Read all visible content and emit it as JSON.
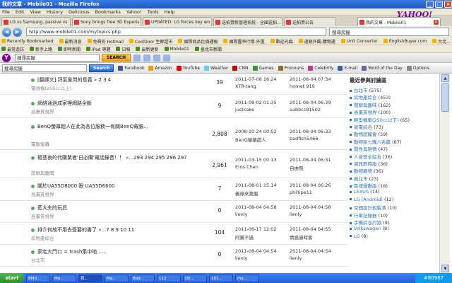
{
  "window": {
    "title": "我的文章 - Mobile01 - Mozilla Firefox",
    "min": "_",
    "max": "□",
    "close": "×"
  },
  "menu": [
    "File",
    "Edit",
    "View",
    "History",
    "Delicious",
    "Bookmarks",
    "Yahoo!",
    "Tools",
    "Help"
  ],
  "tabs": [
    {
      "label": "LG vs Samsung, passive vs act..."
    },
    {
      "label": "Sony brings free 3D Experienc..."
    },
    {
      "label": "UPDATED: LG forces key world..."
    },
    {
      "label": "送拍賣新管理系統 - 全國送拍..."
    },
    {
      "label": "送拍賣公告"
    },
    {
      "label": "我的文章 - Mobile01"
    }
  ],
  "yahoo_logo": "YAHOO!",
  "nav": {
    "back": "◀",
    "forward": "▶",
    "url": "http://www.mobile01.com/mytopics.php",
    "search_value": "搜尋房屋"
  },
  "bookmarks": [
    "Recently Bookmarked",
    "最新消息",
    "免費的 Hotmail",
    "CoolDoor 生鮮超市",
    "國際商品比價通報",
    "國際匯率行情-外匯",
    "歡迎光臨",
    "遠銷外觀-購物通",
    "Unit Converter",
    "EnglishBuyer.com",
    "台北..."
  ],
  "links_bar": [
    "最常造訪",
    "新手上路",
    "即時新聞",
    "iPad 專題",
    "日報",
    "最新更新",
    "Mobile01",
    "臺北市新聞"
  ],
  "ytoolbar": {
    "logo": "Y",
    "search_value": "搜尋房屋",
    "search_label": "SEARCH"
  },
  "ytoolbar2": {
    "search_value": "搜尋房屋",
    "search_label": "Search",
    "items": [
      "Facebook",
      "Amazon",
      "YouTube",
      "Weather",
      "CNN",
      "Games",
      "Pronouns",
      "Celebrity",
      "E-mail",
      "Word of the Day",
      "Options"
    ]
  },
  "rows": [
    {
      "topic": "[翻譯文] 拜氣象閃的意義 » 2 3 4",
      "sub": "電視機(250cc以上)",
      "count": "39",
      "date1": "2011-07-08 16:24",
      "user1": "XTR-tang",
      "date2": "2011-08-04 07:34",
      "user2": "hornet 919"
    },
    {
      "topic": "網絡通過成家裡網路全斷",
      "sub": "高畫質視界",
      "count": "9",
      "date1": "2011-08-02 01:35",
      "user1": "justcake",
      "date2": "2011-08-04 06:39",
      "user2": "aabbcc81502"
    },
    {
      "topic": "BenQ螢幕超人在此為各位服務一有關BenQ電腦...",
      "sub": "電腦螢幕",
      "count": "2,808",
      "date1": "2008-10-24 00:02",
      "user1": "BenQ螢幕超人",
      "date2": "2011-08-04 06:33",
      "user2": "badfish5466"
    },
    {
      "topic": "樞悲哀的代購業者'日必購'電話錄音！！ »...293 294 295 296 297",
      "sub": "閒聊與趣聞",
      "count": "2,961",
      "date1": "2011-03-15 00:13",
      "user1": "Eros Chen",
      "date2": "2011-08-04 06:31",
      "user2": "自由飛"
    },
    {
      "topic": "關於UA55D8000 跟 UA55D6600",
      "sub": "高畫質視界",
      "count": "7",
      "date1": "2011-08-01 15:14",
      "user1": "義祿來蔬龍",
      "date2": "2011-08-04 06:26",
      "user2": "phillipe11"
    },
    {
      "topic": "藍大夫的玩具",
      "sub": "高畫質視界",
      "count": "0",
      "date1": "2011-08-04 04:58",
      "user1": "lienly",
      "date2": "2011-08-04 04:58",
      "user2": "lienly"
    },
    {
      "topic": "排介何故不用去簽要的書了 »...7 8 9 10 11",
      "sub": "房地產綜合",
      "count": "104",
      "date1": "2011-06-17 12:02",
      "user1": "阿寶不過",
      "date2": "2011-08-04 04:55",
      "user2": "情感過時客"
    },
    {
      "topic": "家宅大門口 = trash集中地......",
      "sub": "台北市",
      "count": "0",
      "date1": "2011-08-04 04:54",
      "user1": "lienly",
      "date2": "2011-08-04 04:54",
      "user2": "lienly"
    }
  ],
  "sidebar": {
    "title": "最近參與討論區",
    "items": [
      {
        "name": "台北市",
        "count": "(575)"
      },
      {
        "name": "房地產綜合",
        "count": "(453)"
      },
      {
        "name": "閒聊與趣味",
        "count": "(162)"
      },
      {
        "name": "高畫質視界",
        "count": "(100)"
      },
      {
        "name": "輕型機車(250cc以下)",
        "count": "(65)"
      },
      {
        "name": "家電綜合",
        "count": "(73)"
      },
      {
        "name": "動物超寵會",
        "count": "(59)"
      },
      {
        "name": "動物家七嘴八舌篇",
        "count": "(67)"
      },
      {
        "name": "閒性與戀情",
        "count": "(47)"
      },
      {
        "name": "人身安全綜合",
        "count": "(36)"
      },
      {
        "name": "資訊即時版",
        "count": "(36)"
      },
      {
        "name": "動物寵物",
        "count": "(36)"
      },
      {
        "name": "新北市",
        "count": "(23)"
      },
      {
        "name": "區域運動版",
        "count": "(18)"
      },
      {
        "name": "LEXUS",
        "count": "(14)"
      },
      {
        "name": "LG (Android)",
        "count": "(12)"
      },
      {
        "name": "空間設計與裝潢",
        "count": "(10)"
      },
      {
        "name": "行車記錄器",
        "count": "(10)"
      },
      {
        "name": "手機綜合討論",
        "count": "(9)"
      },
      {
        "name": "Volkswagen",
        "count": "(8)"
      },
      {
        "name": "LG",
        "count": "(8)"
      }
    ]
  },
  "taskbar": {
    "start": "start",
    "tasks": [
      "BMd...",
      "Ma...",
      "我...",
      "Ma...",
      "Bad...",
      "112",
      "DE...",
      "101...",
      "ma..."
    ],
    "tray": "#80967"
  }
}
